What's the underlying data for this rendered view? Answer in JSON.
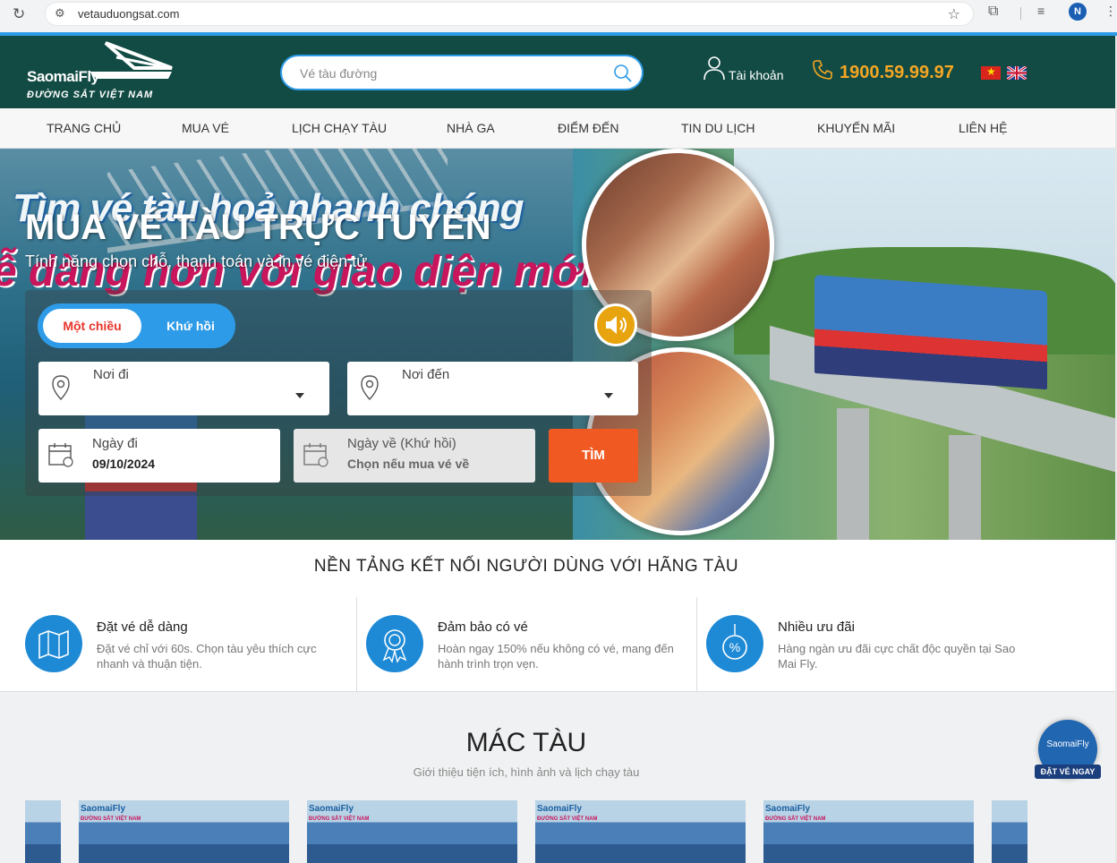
{
  "browser": {
    "url": "vetauduongsat.com",
    "profile_initial": "N"
  },
  "header": {
    "logo_brand": "SaomaiFly",
    "logo_sub": "ĐƯỜNG SẮT VIỆT NAM",
    "search_placeholder": "Vé tàu đường",
    "account_label": "Tài khoản",
    "phone": "1900.59.99.97",
    "colors": {
      "bg": "#124b44",
      "accent": "#2e9be8",
      "phone": "#f5a623"
    }
  },
  "nav": {
    "items": [
      "TRANG CHỦ",
      "MUA VÉ",
      "LỊCH CHẠY TÀU",
      "NHÀ GA",
      "ĐIỂM ĐẾN",
      "TIN DU LỊCH",
      "KHUYẾN MÃI",
      "LIÊN HỆ"
    ]
  },
  "hero": {
    "banner_text_1": "Tìm vé tàu hoả nhanh chóng",
    "banner_text_2": "ễ dàng hơn với giao diện mới",
    "title": "MUA VÉ TÀU TRỰC TUYẾN",
    "subtitle": "Tính năng chọn chỗ, thanh toán và in vé điện tử",
    "trip_type": {
      "one_way": "Một chiều",
      "round_trip": "Khứ hồi",
      "selected": "Một chiều"
    },
    "from_label": "Nơi đi",
    "to_label": "Nơi đến",
    "depart_label": "Ngày đi",
    "depart_value": "09/10/2024",
    "return_label": "Ngày về (Khứ hồi)",
    "return_value": "Chọn nếu mua vé về",
    "search_button": "TÌM",
    "colors": {
      "toggle": "#2e9be8",
      "button": "#f05a22",
      "sound": "#e8a40e"
    }
  },
  "platform": {
    "title": "NỀN TẢNG KẾT NỐI NGƯỜI DÙNG VỚI HÃNG TÀU",
    "features": [
      {
        "title": "Đặt vé dễ dàng",
        "desc": "Đặt vé chỉ với 60s. Chọn tàu yêu thích cực nhanh và thuận tiện.",
        "icon": "map-icon"
      },
      {
        "title": "Đảm bảo có vé",
        "desc": "Hoàn ngay 150% nếu không có vé, mang đến hành trình trọn vẹn.",
        "icon": "badge-icon"
      },
      {
        "title": "Nhiều ưu đãi",
        "desc": "Hàng ngàn ưu đãi cực chất độc quyền tại Sao Mai Fly.",
        "icon": "discount-tag-icon"
      }
    ]
  },
  "trains": {
    "title": "MÁC TÀU",
    "subtitle": "Giới thiệu tiện ích, hình ảnh và lịch chạy tàu",
    "card_brand": "SaomaiFly",
    "card_sub": "ĐƯỜNG SẮT VIỆT NAM"
  },
  "float_button": {
    "brand": "SaomaiFly",
    "label": "ĐẶT VÉ NGAY"
  }
}
